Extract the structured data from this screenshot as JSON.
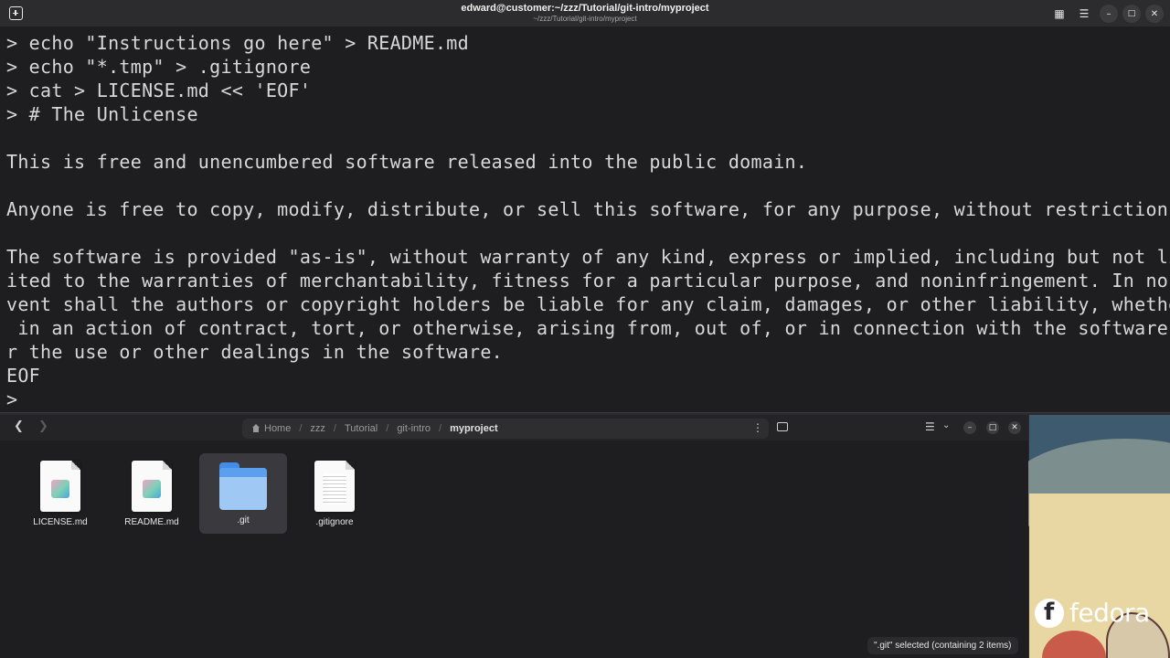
{
  "terminal": {
    "title": "edward@customer:~/zzz/Tutorial/git-intro/myproject",
    "subtitle": "~/zzz/Tutorial/git-intro/myproject",
    "lines": [
      "> echo \"Instructions go here\" > README.md",
      "> echo \"*.tmp\" > .gitignore",
      "> cat > LICENSE.md << 'EOF'",
      "> # The Unlicense",
      "",
      "This is free and unencumbered software released into the public domain.",
      "",
      "Anyone is free to copy, modify, distribute, or sell this software, for any purpose, without restriction.",
      "",
      "The software is provided \"as-is\", without warranty of any kind, express or implied, including but not lim",
      "ited to the warranties of merchantability, fitness for a particular purpose, and noninfringement. In no e",
      "vent shall the authors or copyright holders be liable for any claim, damages, or other liability, whether",
      " in an action of contract, tort, or otherwise, arising from, out of, or in connection with the software o",
      "r the use or other dealings in the software.",
      "EOF",
      ">"
    ]
  },
  "files": {
    "path": {
      "home": "Home",
      "crumbs": [
        "zzz",
        "Tutorial",
        "git-intro"
      ],
      "current": "myproject"
    },
    "items": [
      {
        "name": "LICENSE.md",
        "icon": "markdown-file-icon"
      },
      {
        "name": "README.md",
        "icon": "markdown-file-icon"
      },
      {
        "name": ".git",
        "icon": "folder-icon"
      },
      {
        "name": ".gitignore",
        "icon": "text-file-icon"
      }
    ],
    "status": "\".git\" selected  (containing 2 items)"
  },
  "desktop": {
    "brand": "fedora"
  }
}
